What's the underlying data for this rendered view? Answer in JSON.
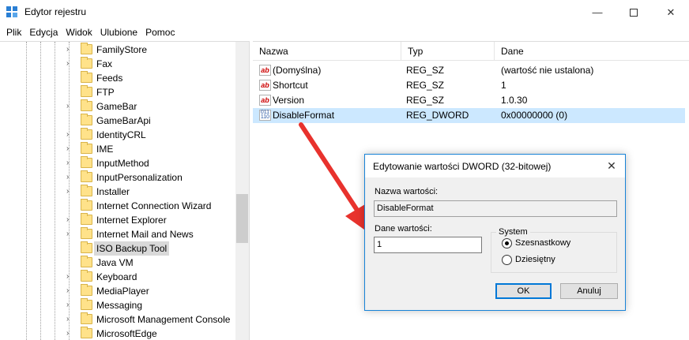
{
  "window": {
    "title": "Edytor rejestru",
    "minimize_icon": "minimize-icon",
    "maximize_icon": "maximize-icon",
    "close_icon": "close-icon"
  },
  "menu": [
    "Plik",
    "Edycja",
    "Widok",
    "Ulubione",
    "Pomoc"
  ],
  "tree": {
    "items": [
      {
        "label": "FamilyStore",
        "expandable": true
      },
      {
        "label": "Fax",
        "expandable": true
      },
      {
        "label": "Feeds",
        "expandable": false
      },
      {
        "label": "FTP",
        "expandable": false
      },
      {
        "label": "GameBar",
        "expandable": true
      },
      {
        "label": "GameBarApi",
        "expandable": false
      },
      {
        "label": "IdentityCRL",
        "expandable": true
      },
      {
        "label": "IME",
        "expandable": true
      },
      {
        "label": "InputMethod",
        "expandable": true
      },
      {
        "label": "InputPersonalization",
        "expandable": true
      },
      {
        "label": "Installer",
        "expandable": true
      },
      {
        "label": "Internet Connection Wizard",
        "expandable": false
      },
      {
        "label": "Internet Explorer",
        "expandable": true
      },
      {
        "label": "Internet Mail and News",
        "expandable": true
      },
      {
        "label": "ISO Backup Tool",
        "expandable": false,
        "selected": true
      },
      {
        "label": "Java VM",
        "expandable": false
      },
      {
        "label": "Keyboard",
        "expandable": true
      },
      {
        "label": "MediaPlayer",
        "expandable": true
      },
      {
        "label": "Messaging",
        "expandable": true
      },
      {
        "label": "Microsoft Management Console",
        "expandable": true
      },
      {
        "label": "MicrosoftEdge",
        "expandable": true
      }
    ]
  },
  "list": {
    "columns": [
      "Nazwa",
      "Typ",
      "Dane"
    ],
    "rows": [
      {
        "icon": "ab",
        "name": "(Domyślna)",
        "type": "REG_SZ",
        "data": "(wartość nie ustalona)"
      },
      {
        "icon": "ab",
        "name": "Shortcut",
        "type": "REG_SZ",
        "data": "1"
      },
      {
        "icon": "ab",
        "name": "Version",
        "type": "REG_SZ",
        "data": "1.0.30"
      },
      {
        "icon": "dword",
        "name": "DisableFormat",
        "type": "REG_DWORD",
        "data": "0x00000000 (0)",
        "selected": true
      }
    ]
  },
  "dialog": {
    "title": "Edytowanie wartości DWORD (32-bitowej)",
    "value_name_label": "Nazwa wartości:",
    "value_name": "DisableFormat",
    "value_data_label": "Dane wartości:",
    "value_data": "1",
    "system_label": "System",
    "radio_hex": "Szesnastkowy",
    "radio_dec": "Dziesiętny",
    "selected_base": "Szesnastkowy",
    "ok_label": "OK",
    "cancel_label": "Anuluj"
  },
  "colors": {
    "selection": "#cce8ff",
    "annotation_arrow": "#e8322d",
    "dialog_border": "#1883d7"
  }
}
